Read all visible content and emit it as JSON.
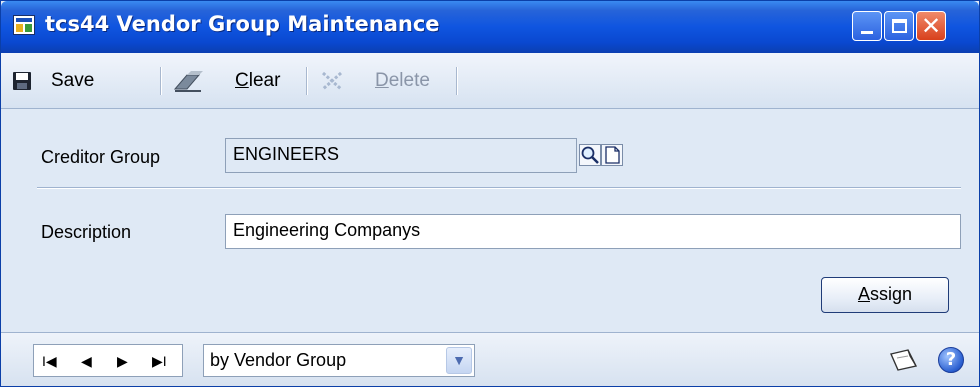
{
  "window": {
    "title": "tcs44 Vendor Group Maintenance",
    "close_glyph": "✕"
  },
  "toolbar": {
    "save_label": "Save",
    "clear_label_first": "C",
    "clear_label_rest": "lear",
    "delete_label_first": "D",
    "delete_label_rest": "elete",
    "delete_enabled": false
  },
  "form": {
    "creditor_group_label": "Creditor Group",
    "creditor_group_value": "ENGINEERS",
    "description_label": "Description",
    "description_value": "Engineering Companys",
    "assign_first": "A",
    "assign_rest": "ssign"
  },
  "footer": {
    "nav": {
      "first": "I◀",
      "prev": "◀",
      "next": "▶",
      "last": "▶I"
    },
    "sort_by": "by Vendor Group",
    "sort_arrow": "▼",
    "help_glyph": "?"
  },
  "colors": {
    "titlebar": "#0f55e0",
    "window_bg": "#dfe9f5",
    "close_button": "#d8401c"
  }
}
